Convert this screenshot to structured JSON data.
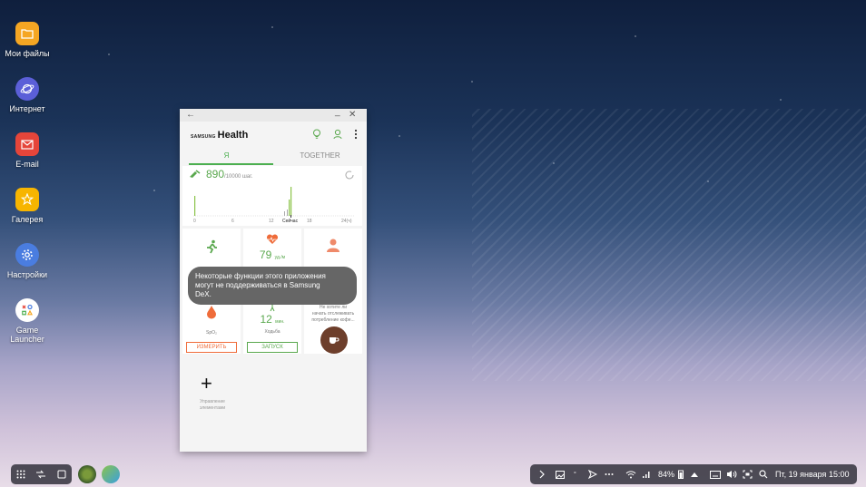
{
  "desktop": {
    "icons": [
      {
        "label": "Мои файлы",
        "icon": "folder-icon",
        "color": "#f5a623"
      },
      {
        "label": "Интернет",
        "icon": "planet-icon",
        "color": "#5b5fd8"
      },
      {
        "label": "E-mail",
        "icon": "mail-icon",
        "color": "#e5453a"
      },
      {
        "label": "Галерея",
        "icon": "flower-icon",
        "color": "#f7b500"
      },
      {
        "label": "Настройки",
        "icon": "gear-icon",
        "color": "#4a7de0"
      },
      {
        "label_line1": "Game",
        "label_line2": "Launcher",
        "icon": "game-launcher-icon",
        "color": "#ffffff"
      }
    ]
  },
  "app": {
    "brand_small": "SAMSUNG",
    "brand_large": "Health",
    "tabs": [
      {
        "label": "Я",
        "active": true
      },
      {
        "label": "TOGETHER",
        "active": false
      }
    ],
    "steps": {
      "value": "890",
      "goal": "/10000 шаг.",
      "axis_ticks": [
        "0",
        "6",
        "12",
        "Сейчас",
        "18",
        "24(ч)"
      ]
    },
    "tiles": {
      "heart_rate": {
        "value": "79",
        "unit": "уд./м"
      },
      "spo2_label": "SpO₂",
      "spo2_button": "ИЗМЕРИТЬ",
      "walk": {
        "value": "12",
        "unit": "мин.",
        "label": "Ходьба",
        "button": "ЗАПУСК"
      },
      "coffee": {
        "line1": "Не хотите ли",
        "line2": "начать отслеживать",
        "line3": "потребление кофе..."
      }
    },
    "manage": {
      "line1": "Управление",
      "line2": "элементами"
    },
    "toast": {
      "line1": "Некоторые функции этого приложения",
      "line2": "могут не поддерживаться в Samsung",
      "line3": "DeX."
    },
    "accent_color": "#4caf50"
  },
  "taskbar": {
    "battery": "84%",
    "datetime": "Пт, 19 января",
    "time": "15:00"
  }
}
